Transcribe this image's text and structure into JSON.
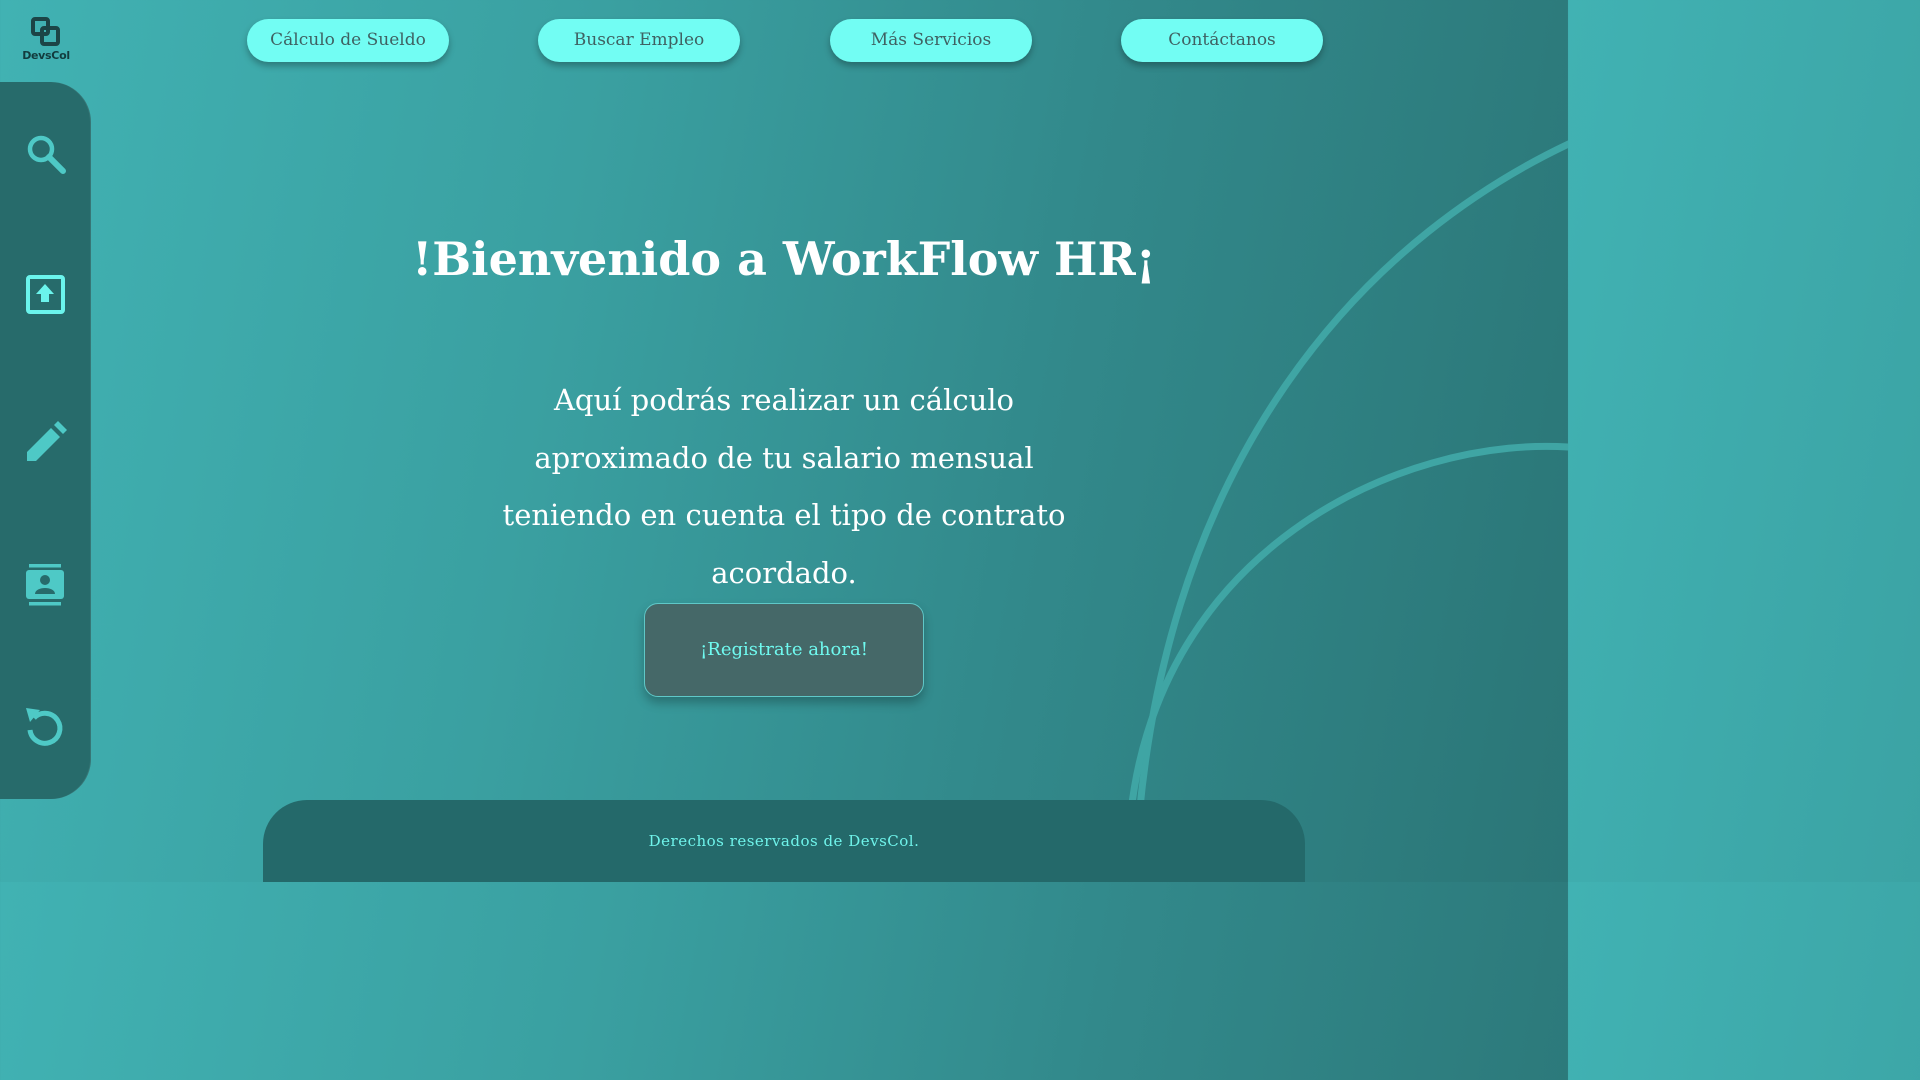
{
  "brand": {
    "logo_text": "DevsCol",
    "logo_icon": "overlapping-squares-icon"
  },
  "nav": {
    "items": [
      {
        "label": "Cálculo de Sueldo"
      },
      {
        "label": "Buscar Empleo"
      },
      {
        "label": "Más Servicios"
      },
      {
        "label": "Contáctanos"
      }
    ]
  },
  "sidebar": {
    "icons": [
      "search-icon",
      "upload-icon",
      "edit-pencil-icon",
      "contact-card-icon",
      "undo-icon"
    ]
  },
  "hero": {
    "title": "!Bienvenido a WorkFlow HR¡",
    "description": "Aquí podrás realizar un cálculo aproximado de tu salario mensual teniendo en cuenta el tipo de contrato acordado.",
    "cta_label": "¡Registrate ahora!"
  },
  "footer": {
    "text": "Derechos reservados de DevsCol."
  },
  "colors": {
    "accent": "#72fdf3",
    "sidebar": "#276b6b",
    "footer": "#24696a",
    "cta_bg": "#456868",
    "cta_text": "#6ff9ef",
    "arc": "#40a9a8"
  }
}
